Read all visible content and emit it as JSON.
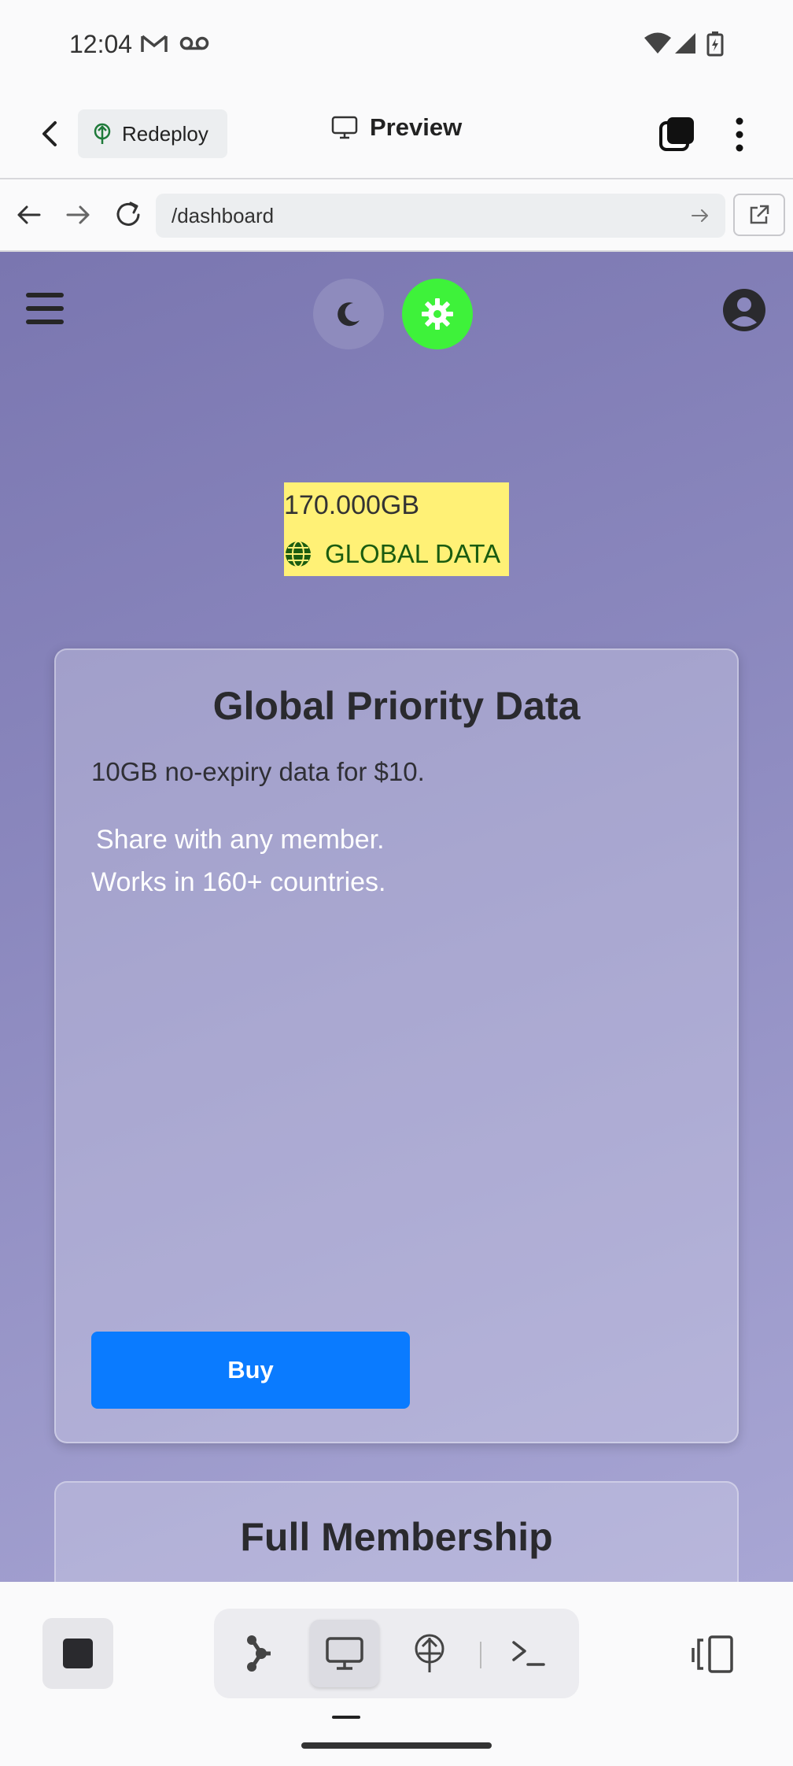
{
  "status": {
    "time": "12:04"
  },
  "header": {
    "redeploy_label": "Redeploy",
    "preview_label": "Preview"
  },
  "browser": {
    "url": "/dashboard"
  },
  "dashboard": {
    "data_amount": "170.000GB",
    "data_label": "GLOBAL DATA",
    "theme_light_color": "#3ef23a",
    "badge_color": "#fff176"
  },
  "cards": [
    {
      "title": "Global Priority Data",
      "description": "10GB no-expiry data for $10.",
      "line1": "Share with any member.",
      "line2": "Works in 160+ countries.",
      "button": "Buy",
      "button_color": "#0a7bff"
    },
    {
      "title": "Full Membership"
    }
  ],
  "toolbar": {
    "tools": [
      "graph-icon",
      "desktop-icon",
      "deploy-icon",
      "terminal-icon"
    ],
    "active_tool": "desktop-icon"
  }
}
